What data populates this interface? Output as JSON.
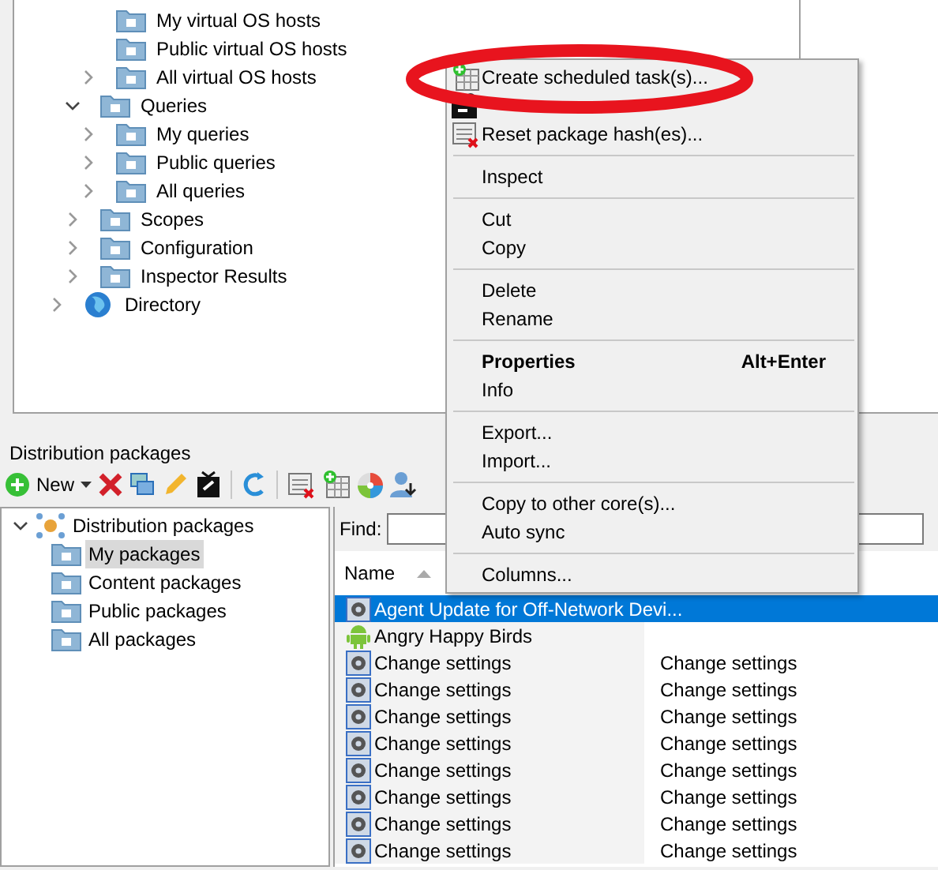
{
  "top_tree": [
    {
      "children": [
        {
          "children": [
            {
              "label": "My virtual OS hosts",
              "kind": "folder"
            },
            {
              "label": "Public virtual OS hosts",
              "kind": "folder"
            },
            {
              "label": "All virtual OS hosts",
              "kind": "folder",
              "expanded": false
            }
          ]
        },
        {
          "label": "Queries",
          "kind": "folder",
          "expanded": true,
          "children": [
            {
              "label": "My queries",
              "kind": "folder",
              "expanded": false
            },
            {
              "label": "Public queries",
              "kind": "folder",
              "expanded": false
            },
            {
              "label": "All queries",
              "kind": "folder",
              "expanded": false
            }
          ]
        },
        {
          "label": "Scopes",
          "kind": "folder",
          "expanded": false
        },
        {
          "label": "Configuration",
          "kind": "folder",
          "expanded": false
        },
        {
          "label": "Inspector Results",
          "kind": "folder",
          "expanded": false
        }
      ]
    },
    {
      "label": "Directory",
      "kind": "globe",
      "expanded": false
    }
  ],
  "packages_panel": {
    "title": "Distribution packages",
    "new_label": "New",
    "tree": {
      "label": "Distribution packages",
      "expanded": true,
      "children": [
        {
          "label": "My packages",
          "selected": true
        },
        {
          "label": "Content packages",
          "selected": false
        },
        {
          "label": "Public packages",
          "selected": false
        },
        {
          "label": "All packages",
          "selected": false
        }
      ]
    },
    "find_label": "Find:",
    "column_1": "Name",
    "rows": [
      {
        "kind": "gear",
        "name": "Agent Update for Off-Network Devi...",
        "selected": true
      },
      {
        "kind": "android",
        "name": "Angry Happy Birds",
        "selected": false
      },
      {
        "kind": "gear",
        "name": "Change settings",
        "column_2": "Change settings",
        "selected": false
      },
      {
        "kind": "gear",
        "name": "Change settings",
        "column_2": "Change settings",
        "selected": false
      },
      {
        "kind": "gear",
        "name": "Change settings",
        "column_2": "Change settings",
        "selected": false
      },
      {
        "kind": "gear",
        "name": "Change settings",
        "column_2": "Change settings",
        "selected": false
      },
      {
        "kind": "gear",
        "name": "Change settings",
        "column_2": "Change settings",
        "selected": false
      },
      {
        "kind": "gear",
        "name": "Change settings",
        "column_2": "Change settings",
        "selected": false
      },
      {
        "kind": "gear",
        "name": "Change settings",
        "column_2": "Change settings",
        "selected": false
      },
      {
        "kind": "gear",
        "name": "Change settings",
        "column_2": "Change settings",
        "selected": false
      }
    ]
  },
  "context_menu": [
    {
      "kind": "item",
      "label": "Create scheduled task(s)...",
      "bold": false
    },
    {
      "kind": "item"
    },
    {
      "kind": "item",
      "label": "Reset package hash(es)...",
      "bold": false
    },
    {
      "kind": "separator"
    },
    {
      "kind": "item",
      "label": "Inspect",
      "bold": false
    },
    {
      "kind": "separator"
    },
    {
      "kind": "item",
      "label": "Cut",
      "bold": false
    },
    {
      "kind": "item",
      "label": "Copy",
      "bold": false
    },
    {
      "kind": "separator"
    },
    {
      "kind": "item",
      "label": "Delete",
      "bold": false
    },
    {
      "kind": "item",
      "label": "Rename",
      "bold": false
    },
    {
      "kind": "separator"
    },
    {
      "kind": "item",
      "label": "Properties",
      "bold": true,
      "shortcut": "Alt+Enter"
    },
    {
      "kind": "item",
      "label": "Info",
      "bold": false
    },
    {
      "kind": "separator"
    },
    {
      "kind": "item",
      "label": "Export...",
      "bold": false
    },
    {
      "kind": "item",
      "label": "Import...",
      "bold": false
    },
    {
      "kind": "separator"
    },
    {
      "kind": "item",
      "label": "Copy to other core(s)...",
      "bold": false
    },
    {
      "kind": "item",
      "label": "Auto sync",
      "bold": false
    },
    {
      "kind": "separator"
    },
    {
      "kind": "item",
      "label": "Columns...",
      "bold": false
    }
  ],
  "highlight": {
    "kind": "ellipse"
  }
}
